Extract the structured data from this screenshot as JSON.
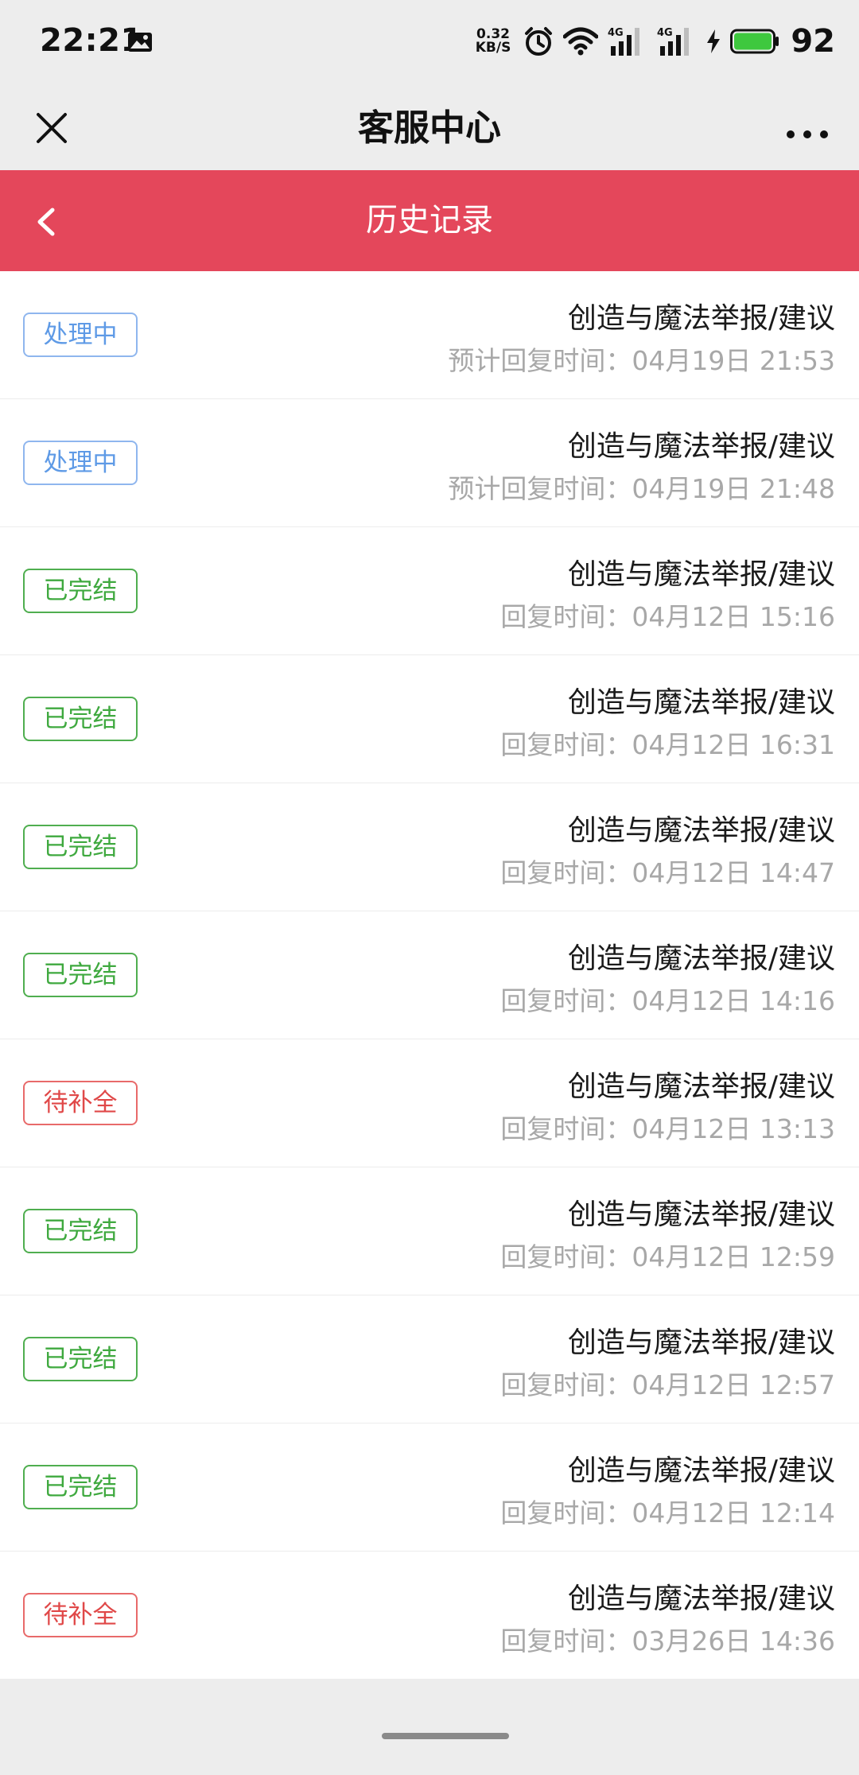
{
  "status_bar": {
    "time": "22:21",
    "net_speed_value": "0.32",
    "net_speed_unit": "KB/S",
    "network_label_1": "4G",
    "network_label_2": "4G",
    "battery_percent": "92",
    "battery_color": "#3ec83e"
  },
  "nav": {
    "title": "客服中心"
  },
  "header": {
    "title": "历史记录",
    "color": "#e4475b"
  },
  "records": [
    {
      "status": "处理中",
      "status_type": "processing",
      "title": "创造与魔法举报/建议",
      "time": "预计回复时间：04月19日 21:53"
    },
    {
      "status": "处理中",
      "status_type": "processing",
      "title": "创造与魔法举报/建议",
      "time": "预计回复时间：04月19日 21:48"
    },
    {
      "status": "已完结",
      "status_type": "completed",
      "title": "创造与魔法举报/建议",
      "time": "回复时间：04月12日 15:16"
    },
    {
      "status": "已完结",
      "status_type": "completed",
      "title": "创造与魔法举报/建议",
      "time": "回复时间：04月12日 16:31"
    },
    {
      "status": "已完结",
      "status_type": "completed",
      "title": "创造与魔法举报/建议",
      "time": "回复时间：04月12日 14:47"
    },
    {
      "status": "已完结",
      "status_type": "completed",
      "title": "创造与魔法举报/建议",
      "time": "回复时间：04月12日 14:16"
    },
    {
      "status": "待补全",
      "status_type": "pending",
      "title": "创造与魔法举报/建议",
      "time": "回复时间：04月12日 13:13"
    },
    {
      "status": "已完结",
      "status_type": "completed",
      "title": "创造与魔法举报/建议",
      "time": "回复时间：04月12日 12:59"
    },
    {
      "status": "已完结",
      "status_type": "completed",
      "title": "创造与魔法举报/建议",
      "time": "回复时间：04月12日 12:57"
    },
    {
      "status": "已完结",
      "status_type": "completed",
      "title": "创造与魔法举报/建议",
      "time": "回复时间：04月12日 12:14"
    },
    {
      "status": "待补全",
      "status_type": "pending",
      "title": "创造与魔法举报/建议",
      "time": "回复时间：03月26日 14:36"
    }
  ],
  "status_colors": {
    "processing": "#5e9ae6",
    "completed": "#3fa93f",
    "pending": "#e04848"
  }
}
